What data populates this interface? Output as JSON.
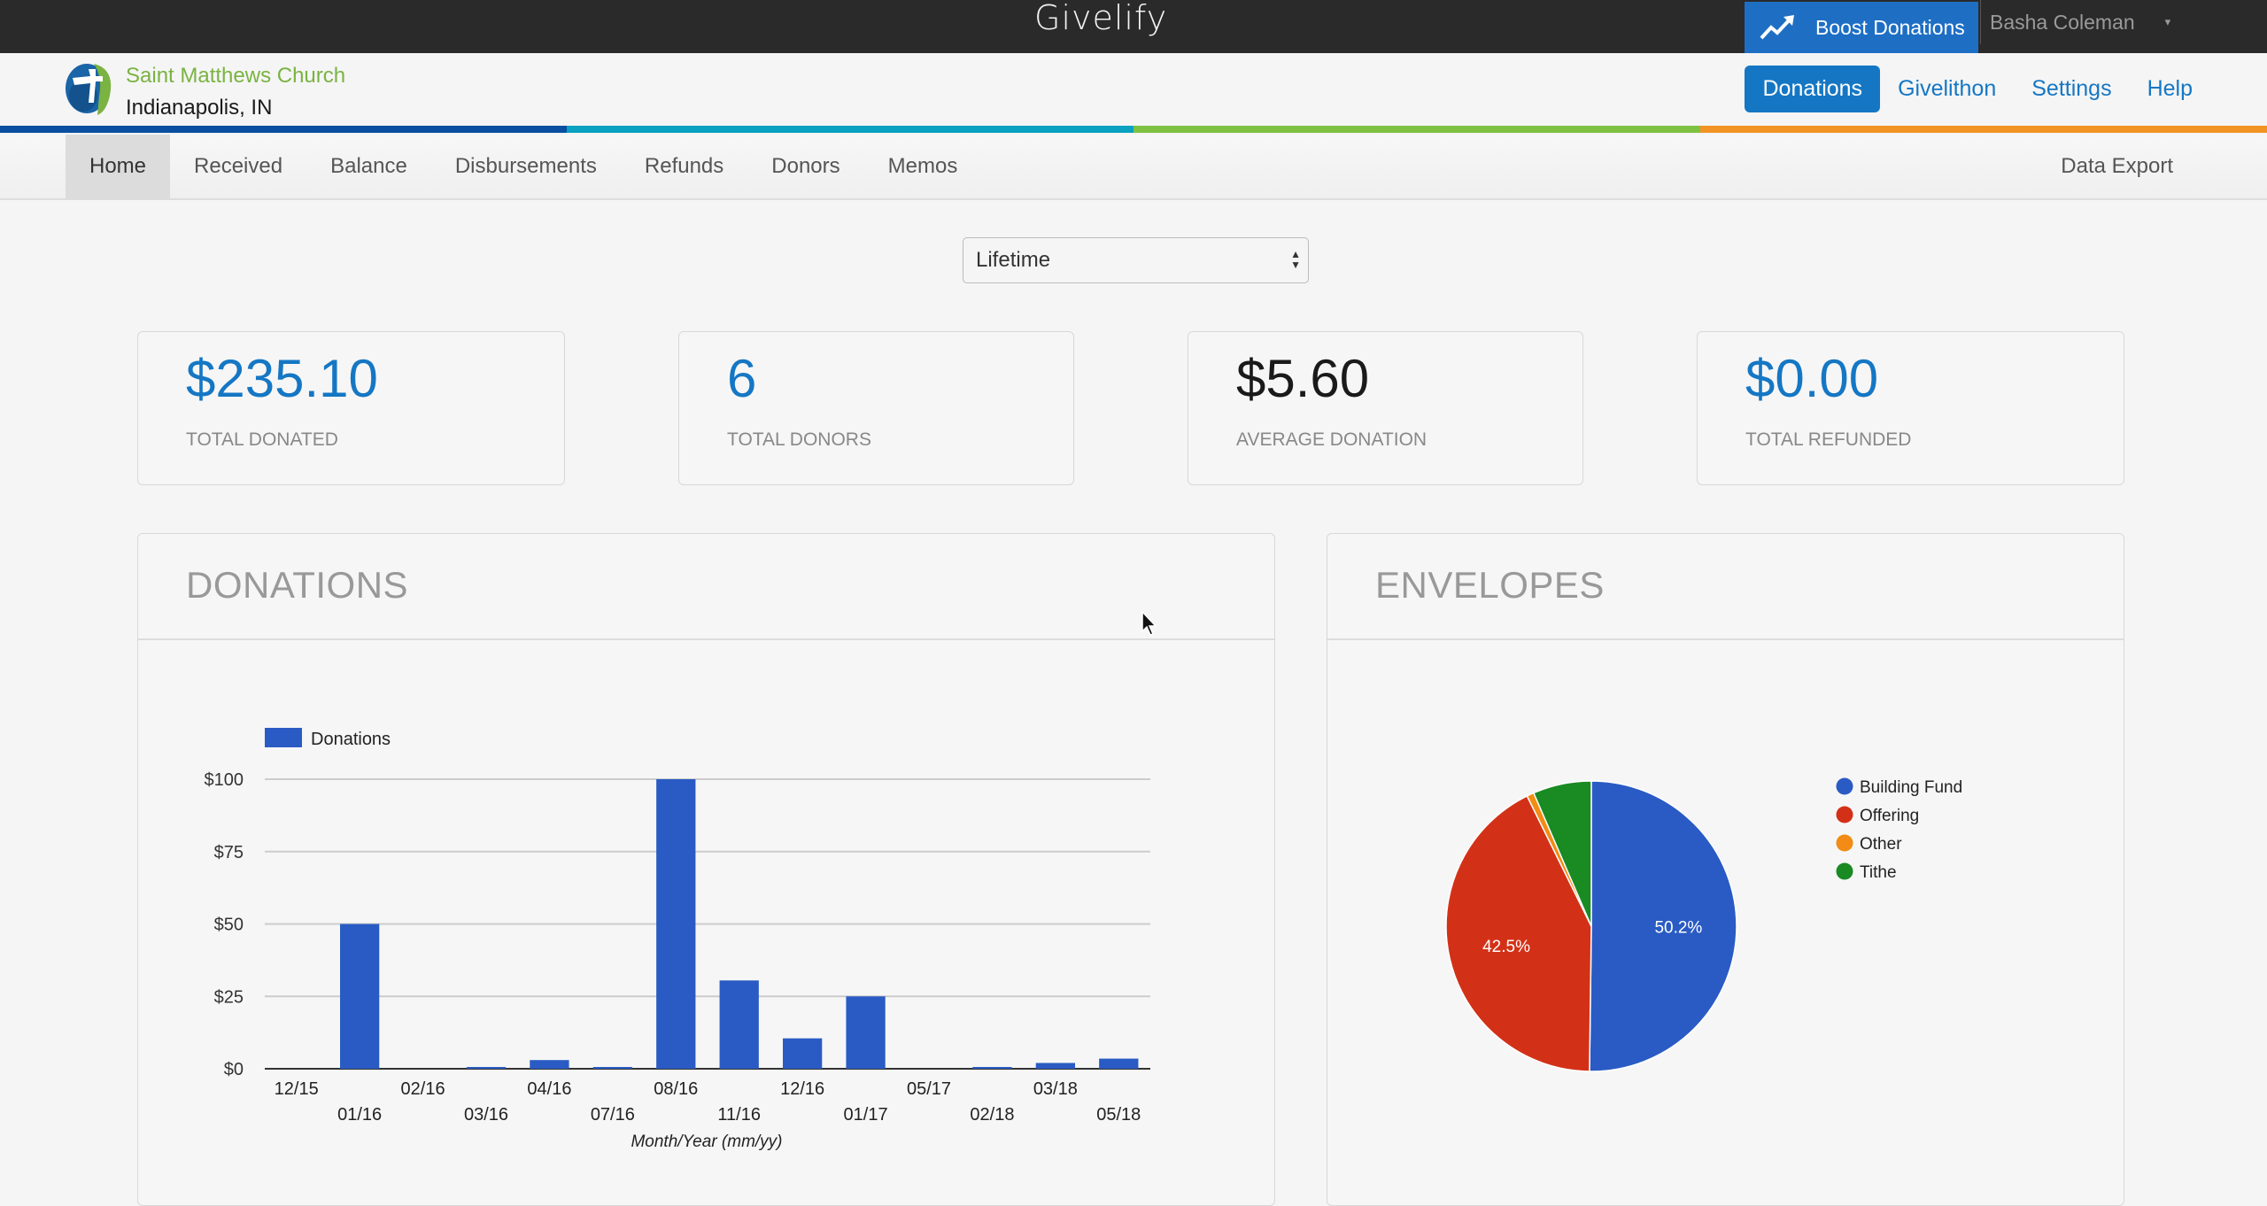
{
  "topbar": {
    "brand": "Givelify",
    "boost_label": "Boost Donations",
    "boost_icon": "trending-up-icon",
    "user_name": "Basha Coleman",
    "user_caret": "▾"
  },
  "org": {
    "name": "Saint Matthews Church",
    "city": "Indianapolis, IN"
  },
  "main_nav": [
    {
      "label": "Donations",
      "active": true
    },
    {
      "label": "Givelithon",
      "active": false
    },
    {
      "label": "Settings",
      "active": false
    },
    {
      "label": "Help",
      "active": false
    }
  ],
  "color_strip": [
    "#0a4fa0",
    "#0aa2c0",
    "#7fc142",
    "#f29424"
  ],
  "sub_nav": [
    {
      "label": "Home",
      "active": true
    },
    {
      "label": "Received",
      "active": false
    },
    {
      "label": "Balance",
      "active": false
    },
    {
      "label": "Disbursements",
      "active": false
    },
    {
      "label": "Refunds",
      "active": false
    },
    {
      "label": "Donors",
      "active": false
    },
    {
      "label": "Memos",
      "active": false
    }
  ],
  "data_export_label": "Data Export",
  "range_select": {
    "value": "Lifetime"
  },
  "stats": [
    {
      "value": "$235.10",
      "label": "TOTAL DONATED"
    },
    {
      "value": "6",
      "label": "TOTAL DONORS"
    },
    {
      "value": "$5.60",
      "label": "AVERAGE DONATION"
    },
    {
      "value": "$0.00",
      "label": "TOTAL REFUNDED"
    }
  ],
  "panels": {
    "donations_title": "DONATIONS",
    "envelopes_title": "ENVELOPES"
  },
  "colors": {
    "accent": "#1577c4",
    "bar": "#2a5bc4"
  },
  "chart_data": [
    {
      "type": "bar",
      "title": "DONATIONS",
      "legend": [
        "Donations"
      ],
      "legend_position": "top-left",
      "categories": [
        "12/15",
        "01/16",
        "02/16",
        "03/16",
        "04/16",
        "07/16",
        "08/16",
        "11/16",
        "12/16",
        "01/17",
        "05/17",
        "02/18",
        "03/18",
        "05/18"
      ],
      "values": [
        0,
        50,
        0,
        0.5,
        3,
        0.5,
        100,
        30.5,
        10.5,
        25,
        0,
        0.5,
        2,
        3.5
      ],
      "xlabel": "Month/Year (mm/yy)",
      "ylabel": "",
      "yticks": [
        "$0",
        "$25",
        "$50",
        "$75",
        "$100"
      ],
      "ytick_values": [
        0,
        25,
        50,
        75,
        100
      ],
      "ylim": [
        0,
        100
      ],
      "grid": true,
      "color": "#2a5bc4"
    },
    {
      "type": "pie",
      "title": "ENVELOPES",
      "legend_position": "right",
      "slices": [
        {
          "label": "Building Fund",
          "value": 50.2,
          "color": "#2a5bc4",
          "show_label": "50.2%"
        },
        {
          "label": "Offering",
          "value": 42.5,
          "color": "#d33117",
          "show_label": "42.5%"
        },
        {
          "label": "Other",
          "value": 0.8,
          "color": "#f28c14",
          "show_label": ""
        },
        {
          "label": "Tithe",
          "value": 6.5,
          "color": "#1a8a23",
          "show_label": ""
        }
      ]
    }
  ]
}
